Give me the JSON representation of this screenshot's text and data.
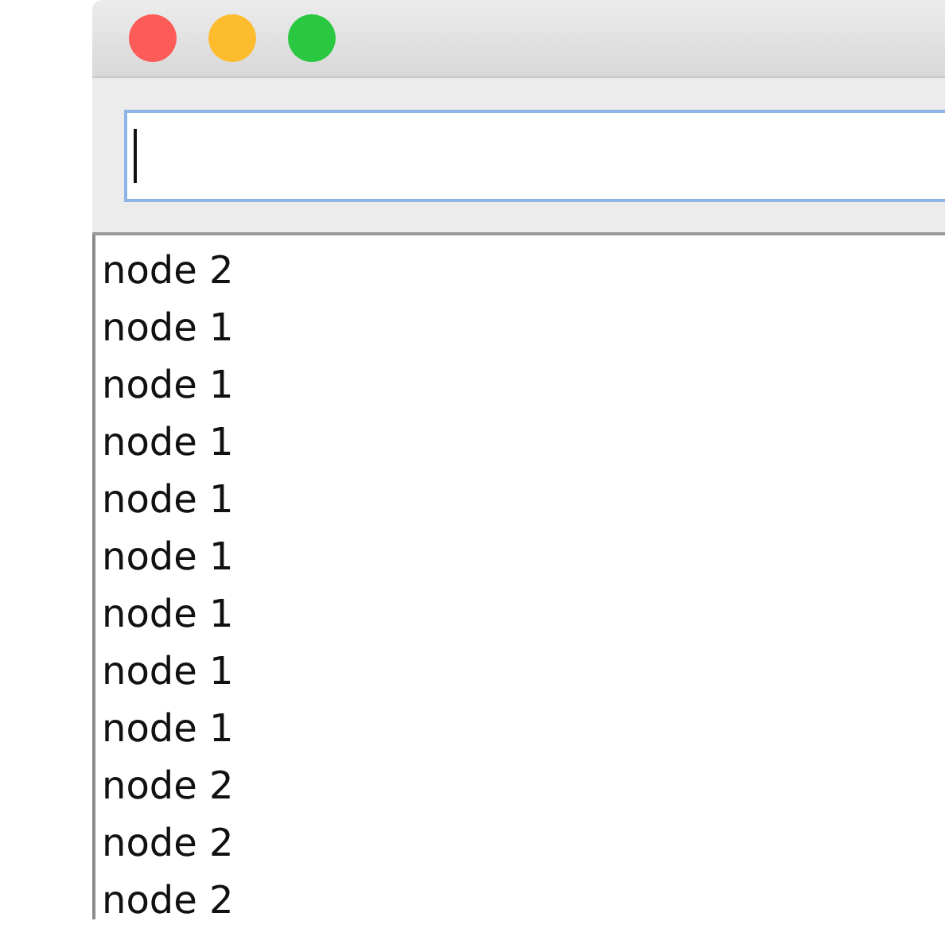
{
  "list": {
    "items": [
      "node 2",
      "node 1",
      "node 1",
      "node 1",
      "node 1",
      "node 1",
      "node 1",
      "node 1",
      "node 1",
      "node 2",
      "node 2",
      "node 2"
    ]
  }
}
